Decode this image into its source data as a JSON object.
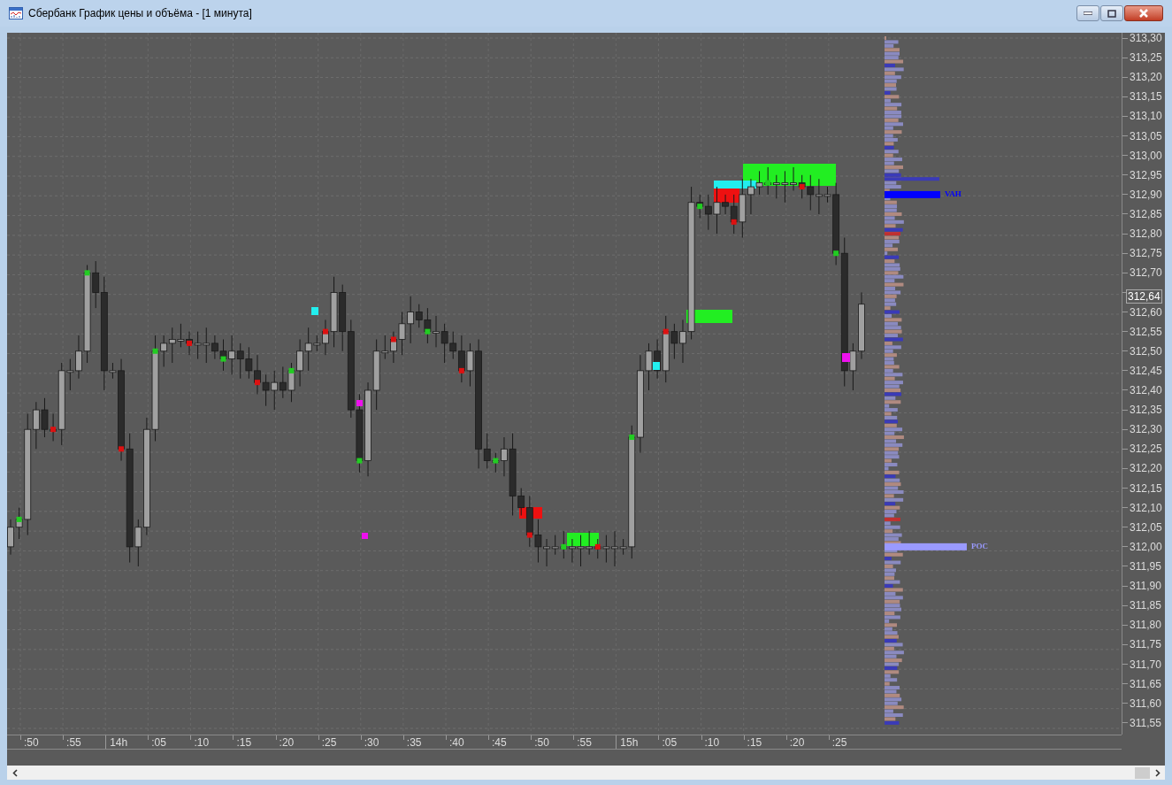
{
  "window": {
    "title": "Сбербанк График цены и объёма - [1 минута]"
  },
  "price_axis": {
    "ticks": [
      "313,30",
      "313,25",
      "313,20",
      "313,15",
      "313,10",
      "313,05",
      "313,00",
      "312,95",
      "312,90",
      "312,85",
      "312,80",
      "312,75",
      "312,70",
      "312,60",
      "312,55",
      "312,50",
      "312,45",
      "312,40",
      "312,35",
      "312,30",
      "312,25",
      "312,20",
      "312,15",
      "312,10",
      "312,05",
      "312,00",
      "311,95",
      "311,90",
      "311,85",
      "311,80",
      "311,75",
      "311,70",
      "311,65",
      "311,60",
      "311,55"
    ],
    "current_price": "312,64"
  },
  "time_axis": {
    "ticks": [
      {
        "label": ":50",
        "kind": "minute"
      },
      {
        "label": ":55",
        "kind": "minute"
      },
      {
        "label": "14h",
        "kind": "hour"
      },
      {
        "label": ":05",
        "kind": "minute"
      },
      {
        "label": ":10",
        "kind": "minute"
      },
      {
        "label": ":15",
        "kind": "minute"
      },
      {
        "label": ":20",
        "kind": "minute"
      },
      {
        "label": ":25",
        "kind": "minute"
      },
      {
        "label": ":30",
        "kind": "minute"
      },
      {
        "label": ":35",
        "kind": "minute"
      },
      {
        "label": ":40",
        "kind": "minute"
      },
      {
        "label": ":45",
        "kind": "minute"
      },
      {
        "label": ":50",
        "kind": "minute"
      },
      {
        "label": ":55",
        "kind": "minute"
      },
      {
        "label": "15h",
        "kind": "hour"
      },
      {
        "label": ":05",
        "kind": "minute"
      },
      {
        "label": ":10",
        "kind": "minute"
      },
      {
        "label": ":15",
        "kind": "minute"
      },
      {
        "label": ":20",
        "kind": "minute"
      },
      {
        "label": ":25",
        "kind": "minute"
      }
    ]
  },
  "volume_profile": {
    "markers": [
      {
        "label": "VAH",
        "kind": "vah"
      },
      {
        "label": "POC",
        "kind": "poc"
      }
    ]
  }
}
